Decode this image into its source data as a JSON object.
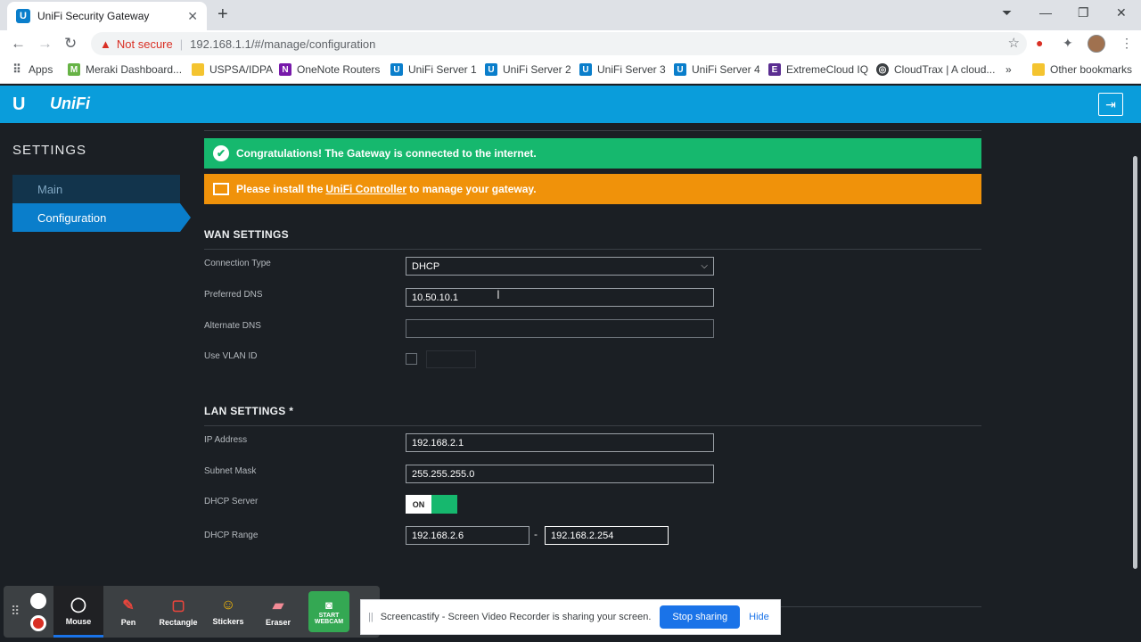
{
  "browser": {
    "tab_title": "UniFi Security Gateway",
    "tab_favicon": "U",
    "not_secure": "Not secure",
    "url": "192.168.1.1/#/manage/configuration",
    "bookmarks": [
      {
        "label": "Apps",
        "icon": "apps-grid-icon",
        "color": "#5f6368"
      },
      {
        "label": "Meraki Dashboard...",
        "icon": "meraki-icon",
        "color": "#67b346"
      },
      {
        "label": "USPSA/IDPA",
        "icon": "folder-icon",
        "color": "#f4c430"
      },
      {
        "label": "OneNote Routers",
        "icon": "onenote-icon",
        "color": "#7719aa"
      },
      {
        "label": "UniFi Server 1",
        "icon": "unifi-icon",
        "color": "#0a7ecb"
      },
      {
        "label": "UniFi Server 2",
        "icon": "unifi-icon",
        "color": "#0a7ecb"
      },
      {
        "label": "UniFi Server 3",
        "icon": "unifi-icon",
        "color": "#0a7ecb"
      },
      {
        "label": "UniFi Server 4",
        "icon": "unifi-icon",
        "color": "#0a7ecb"
      },
      {
        "label": "ExtremeCloud IQ",
        "icon": "extreme-icon",
        "color": "#5a2d91"
      },
      {
        "label": "CloudTrax | A cloud...",
        "icon": "cloudtrax-icon",
        "color": "#3c4043"
      }
    ],
    "other_bookmarks": "Other bookmarks"
  },
  "header": {
    "logo": "U",
    "brand": "UniFi"
  },
  "sidebar": {
    "title": "SETTINGS",
    "items": [
      {
        "label": "Main"
      },
      {
        "label": "Configuration"
      }
    ]
  },
  "banners": {
    "success": "Congratulations! The Gateway is connected to the internet.",
    "install_prefix": "Please install the",
    "install_link": "UniFi Controller",
    "install_suffix": "to manage your gateway."
  },
  "wan": {
    "title": "WAN SETTINGS",
    "connection_type_label": "Connection Type",
    "connection_type_value": "DHCP",
    "preferred_dns_label": "Preferred DNS",
    "preferred_dns_value": "10.50.10.1",
    "alternate_dns_label": "Alternate DNS",
    "alternate_dns_value": "",
    "vlan_label": "Use VLAN ID"
  },
  "lan": {
    "title": "LAN SETTINGS *",
    "ip_label": "IP Address",
    "ip_value": "192.168.2.1",
    "subnet_label": "Subnet Mask",
    "subnet_value": "255.255.255.0",
    "dhcp_server_label": "DHCP Server",
    "dhcp_server_state": "ON",
    "dhcp_range_label": "DHCP Range",
    "dhcp_start": "192.168.2.6",
    "dhcp_sep": "-",
    "dhcp_end": "192.168.2.254"
  },
  "screencastify": {
    "tools": [
      "Mouse",
      "Pen",
      "Rectangle",
      "Stickers",
      "Eraser"
    ],
    "webcam_line1": "START",
    "webcam_line2": "WEBCAM",
    "share_text": "Screencastify - Screen Video Recorder is sharing your screen.",
    "stop_sharing": "Stop sharing",
    "hide": "Hide"
  },
  "colors": {
    "accent": "#0a9ddb",
    "success": "#16b86e",
    "warning": "#f0920a",
    "background": "#1b1f24"
  }
}
